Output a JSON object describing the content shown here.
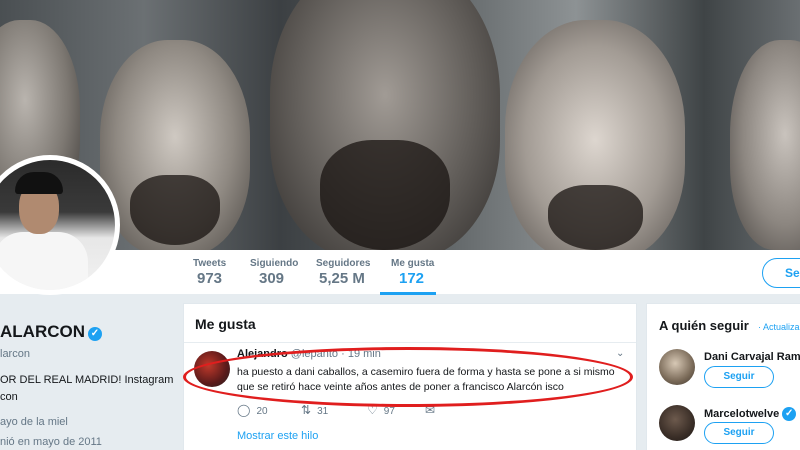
{
  "nav": {
    "stats": [
      {
        "label": "Tweets",
        "value": "973"
      },
      {
        "label": "Siguiendo",
        "value": "309"
      },
      {
        "label": "Seguidores",
        "value": "5,25 M"
      },
      {
        "label": "Me gusta",
        "value": "172"
      }
    ],
    "follow_label": "Seg"
  },
  "profile": {
    "name": "ALARCON",
    "handle": "larcon",
    "bio_line1": "OR DEL REAL MADRID! Instagram",
    "bio_line2": "con",
    "birthday": "ayo de la miel",
    "joined": "nió en mayo de 2011"
  },
  "likes": {
    "title": "Me gusta",
    "tweet": {
      "name": "Alejandro",
      "handle": "@lepanto",
      "time": "· 19 min",
      "text": "ha puesto a dani caballos, a casemiro fuera de forma y hasta se pone a si mismo que se retiró hace veinte años antes de poner a francisco Alarcón isco",
      "replies": "20",
      "retweets": "31",
      "likes": "97",
      "show_thread": "Mostrar este hilo"
    }
  },
  "who_to_follow": {
    "title": "A quién seguir",
    "update": "· Actualizar",
    "suggestions": [
      {
        "name": "Dani Carvajal Ramo",
        "button": "Seguir"
      },
      {
        "name": "Marcelotwelve",
        "button": "Seguir"
      }
    ]
  },
  "colors": {
    "accent": "#1da1f2",
    "highlight_oval": "#e01e1e"
  }
}
